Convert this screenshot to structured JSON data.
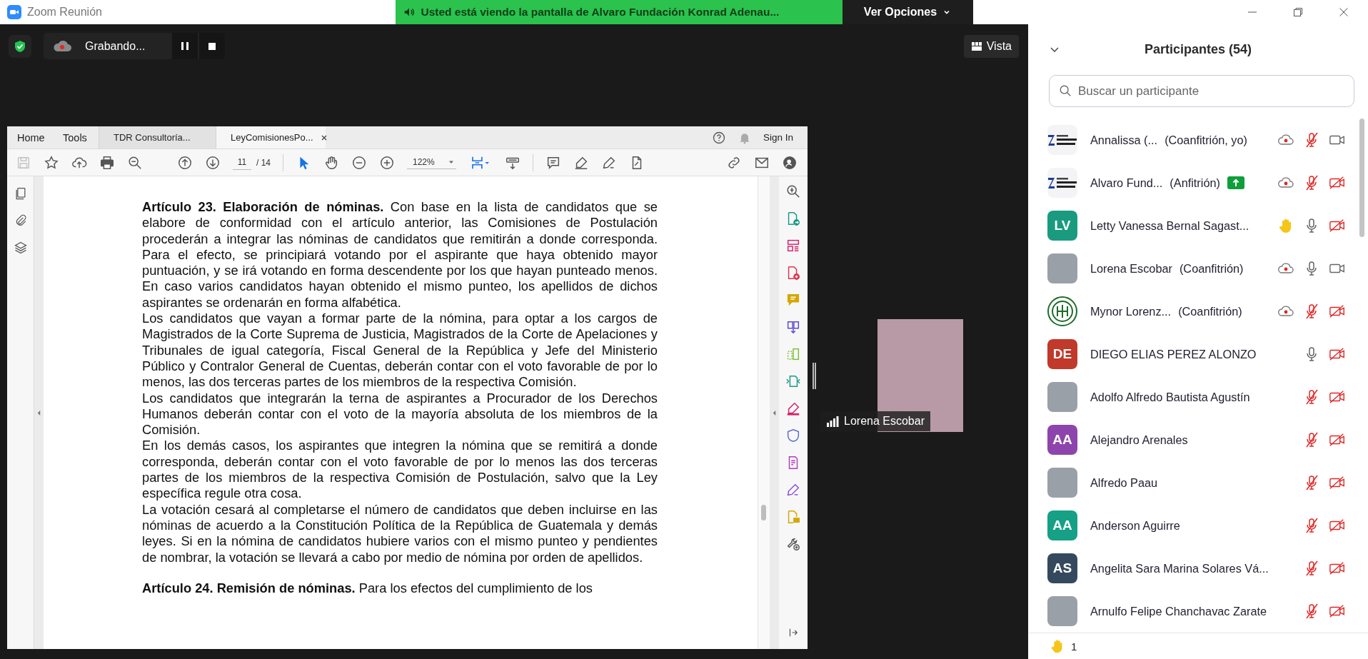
{
  "title_bar": {
    "app_title": "Zoom Reunión",
    "share_banner": "Usted está viendo la pantalla de Alvaro Fundación Konrad Adenau...",
    "view_options": "Ver Opciones"
  },
  "meeting": {
    "recording_label": "Grabando...",
    "view_button": "Vista",
    "video_tile": {
      "name": "Lorena Escobar"
    }
  },
  "pdf_viewer": {
    "menu": [
      "Home",
      "Tools"
    ],
    "tabs": [
      {
        "label": "TDR Consultoría...",
        "selected": false
      },
      {
        "label": "LeyComisionesPo...",
        "selected": true
      }
    ],
    "sign_in": "Sign In",
    "pointer_tools": [
      {
        "kind": "select",
        "selected": true
      },
      {
        "kind": "hand",
        "selected": false
      }
    ],
    "page_current": "11",
    "page_total": "/ 14",
    "zoom": "122%",
    "paragraphs": [
      {
        "kind": "article",
        "text": "**Artículo 23. Elaboración de nóminas.** Con base en la lista de candidatos que se elabore de conformidad con el artículo anterior, las Comisiones de Postulación procederán a integrar las nóminas de candidatos que remitirán a donde corresponda. Para el efecto, se principiará votando por el aspirante que haya obtenido mayor puntuación, y se irá votando en forma descendente por los que hayan punteado menos. En caso varios candidatos hayan obtenido el mismo punteo, los apellidos de dichos aspirantes se ordenarán en forma alfabética."
      },
      {
        "kind": "body",
        "text": "Los candidatos que vayan a formar parte de la nómina, para optar a los cargos de Magistrados de la Corte Suprema de Justicia, Magistrados de la Corte de Apelaciones y Tribunales de igual categoría, Fiscal General de la República y Jefe del Ministerio Público y Contralor General de Cuentas, deberán contar con el voto favorable de por lo menos, las dos terceras partes de los miembros de la respectiva Comisión."
      },
      {
        "kind": "body",
        "text": "Los candidatos que integrarán la terna de aspirantes a Procurador de los Derechos Humanos deberán contar con el voto de la mayoría absoluta de los miembros de la Comisión."
      },
      {
        "kind": "body",
        "text": "En los demás casos, los aspirantes que integren la nómina que se remitirá a donde corresponda, deberán contar con el voto favorable de por lo menos las dos terceras partes de los miembros de la respectiva Comisión de Postulación, salvo que la Ley específica regule otra cosa."
      },
      {
        "kind": "body",
        "text": "La votación cesará al completarse el número de candidatos que deben incluirse en las nóminas de acuerdo a la Constitución Política de la República de Guatemala y demás leyes. Si en la nómina de candidatos hubiere varios con el mismo punteo y pendientes de nombrar, la votación se llevará a cabo por medio de nómina por orden de apellidos."
      },
      {
        "kind": "article",
        "text": "**Artículo 24. Remisión de nóminas.** Para los efectos del cumplimiento de los"
      }
    ]
  },
  "participants": {
    "title": "Participantes (54)",
    "search": {
      "placeholder": "Buscar un participante"
    },
    "list": [
      {
        "name": "Annalissa (...",
        "role": "(Coanfitrión, yo)",
        "avatar": {
          "kind": "logo"
        },
        "sharing": false,
        "recording": true,
        "hand_raised": false,
        "muted": true,
        "video_on": true
      },
      {
        "name": "Alvaro Fund...",
        "role": "(Anfitrión)",
        "avatar": {
          "kind": "logo"
        },
        "sharing": true,
        "recording": true,
        "hand_raised": false,
        "muted": true,
        "video_on": false
      },
      {
        "name": "Letty Vanessa Bernal Sagast...",
        "avatar": {
          "kind": "initials",
          "initials": "LV",
          "color": "#1a9b7f"
        },
        "sharing": false,
        "recording": false,
        "hand_raised": true,
        "muted": false,
        "video_on": false
      },
      {
        "name": "Lorena Escobar",
        "role": "(Coanfitrión)",
        "avatar": {
          "kind": "photo"
        },
        "sharing": false,
        "recording": true,
        "hand_raised": false,
        "muted": false,
        "video_on": true
      },
      {
        "name": "Mynor Lorenz...",
        "role": "(Coanfitrión)",
        "avatar": {
          "kind": "seal"
        },
        "sharing": false,
        "recording": true,
        "hand_raised": false,
        "muted": true,
        "video_on": false
      },
      {
        "name": "DIEGO ELIAS PEREZ ALONZO",
        "avatar": {
          "kind": "initials",
          "initials": "DE",
          "color": "#c0392b"
        },
        "sharing": false,
        "recording": false,
        "hand_raised": false,
        "muted": false,
        "video_on": false
      },
      {
        "name": "Adolfo Alfredo Bautista Agustín",
        "avatar": {
          "kind": "photo"
        },
        "sharing": false,
        "recording": false,
        "hand_raised": false,
        "muted": true,
        "video_on": false
      },
      {
        "name": "Alejandro Arenales",
        "avatar": {
          "kind": "initials",
          "initials": "AA",
          "color": "#8e44ad"
        },
        "sharing": false,
        "recording": false,
        "hand_raised": false,
        "muted": true,
        "video_on": false
      },
      {
        "name": "Alfredo Paau",
        "avatar": {
          "kind": "photo"
        },
        "sharing": false,
        "recording": false,
        "hand_raised": false,
        "muted": true,
        "video_on": false
      },
      {
        "name": "Anderson Aguirre",
        "avatar": {
          "kind": "initials",
          "initials": "AA",
          "color": "#16a085"
        },
        "sharing": false,
        "recording": false,
        "hand_raised": false,
        "muted": true,
        "video_on": false
      },
      {
        "name": "Angelita Sara Marina Solares Vá...",
        "avatar": {
          "kind": "initials",
          "initials": "AS",
          "color": "#34495e"
        },
        "sharing": false,
        "recording": false,
        "hand_raised": false,
        "muted": true,
        "video_on": false
      },
      {
        "name": "Arnulfo Felipe Chanchavac Zarate",
        "avatar": {
          "kind": "photo"
        },
        "sharing": false,
        "recording": false,
        "hand_raised": false,
        "muted": true,
        "video_on": false
      }
    ],
    "raised_hands": "1"
  }
}
